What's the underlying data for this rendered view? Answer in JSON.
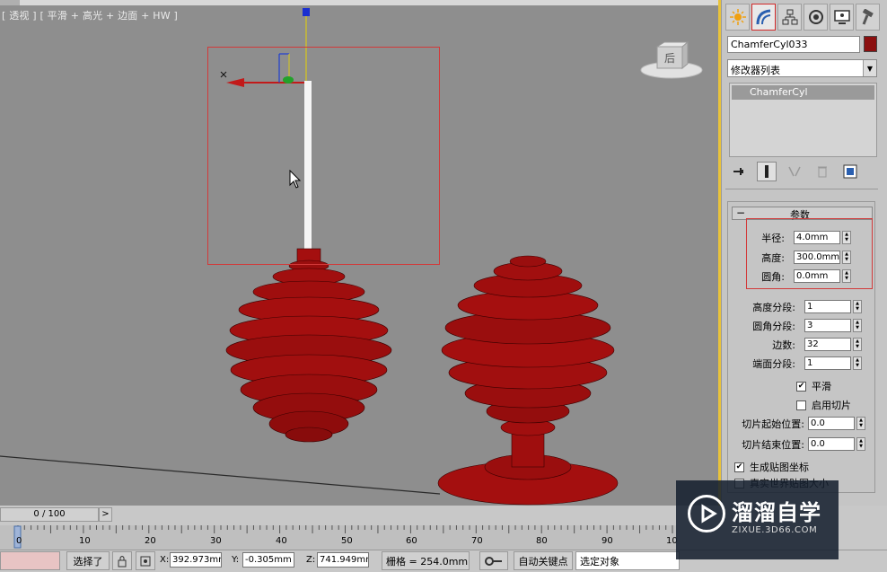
{
  "viewport": {
    "label": "[ 透视 ] [ 平滑 + 高光 + 边面 + HW ]",
    "viewcube_label": "后"
  },
  "command_panel": {
    "tabs": [
      {
        "name": "create",
        "icon": "sun-icon"
      },
      {
        "name": "modify",
        "icon": "bend-icon",
        "active": true
      },
      {
        "name": "hierarchy",
        "icon": "hierarchy-icon"
      },
      {
        "name": "motion",
        "icon": "motion-icon"
      },
      {
        "name": "display",
        "icon": "display-icon"
      },
      {
        "name": "utilities",
        "icon": "hammer-icon"
      }
    ],
    "object_name": "ChamferCyl033",
    "object_color": "#8b0f0f",
    "modifier_list": "修改器列表",
    "stack_item": "ChamferCyl",
    "rollout_title": "参数",
    "params": {
      "radius_label": "半径:",
      "radius": "4.0mm",
      "height_label": "高度:",
      "height": "300.0mm",
      "fillet_label": "圆角:",
      "fillet": "0.0mm",
      "height_segs_label": "高度分段:",
      "height_segs": "1",
      "fillet_segs_label": "圆角分段:",
      "fillet_segs": "3",
      "sides_label": "边数:",
      "sides": "32",
      "cap_segs_label": "端面分段:",
      "cap_segs": "1",
      "smooth_label": "平滑",
      "smooth_checked": "✔",
      "slice_on_label": "启用切片",
      "slice_from_label": "切片起始位置:",
      "slice_from": "0.0",
      "slice_to_label": "切片结束位置:",
      "slice_to": "0.0",
      "gen_map_label": "生成贴图坐标",
      "gen_map_checked": "✔",
      "real_world_label": "真实世界贴图大小"
    }
  },
  "timeline": {
    "frame_display": "0 / 100",
    "next_label": ">",
    "ticks": [
      "0",
      "10",
      "20",
      "30",
      "40",
      "50",
      "60",
      "70",
      "80",
      "90",
      "10"
    ]
  },
  "status": {
    "selected": "选择了",
    "x_label": "X:",
    "x_value": "392.973mr",
    "y_label": "Y:",
    "y_value": "-0.305mm",
    "z_label": "Z:",
    "z_value": "741.949mr",
    "grid": "栅格 = 254.0mm",
    "auto_key": "自动关键点",
    "sel_set": "选定对象"
  },
  "watermark": {
    "title": "溜溜自学",
    "url": "ZIXUE.3D66.COM"
  }
}
